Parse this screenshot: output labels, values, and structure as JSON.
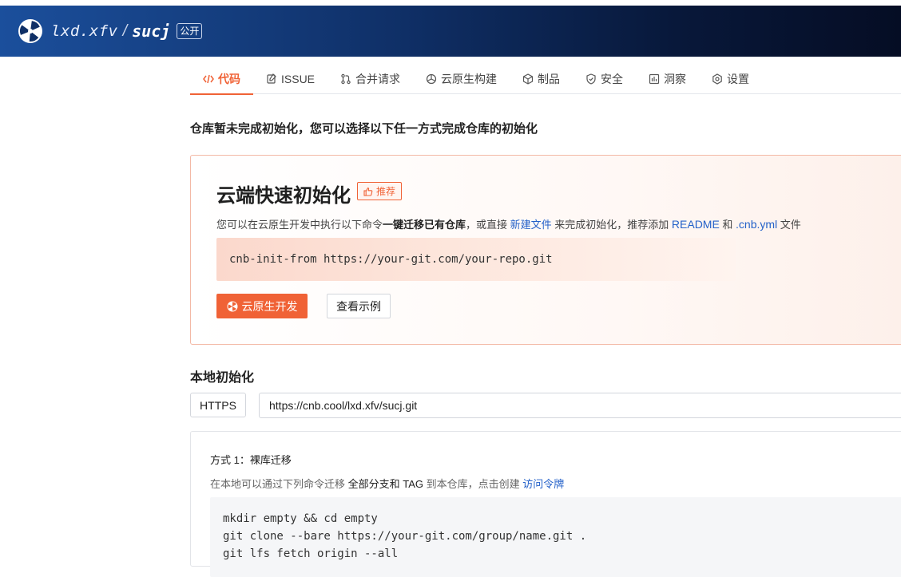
{
  "header": {
    "org": "lxd.xfv",
    "separator": "/",
    "repo": "sucj",
    "visibility_badge": "公开",
    "gradient_colors": [
      "#1b4f9c",
      "#050d24"
    ]
  },
  "tabs": [
    {
      "label": "代码",
      "icon": "code-icon",
      "active": true
    },
    {
      "label": "ISSUE",
      "icon": "issue-icon",
      "active": false
    },
    {
      "label": "合并请求",
      "icon": "pull-request-icon",
      "active": false
    },
    {
      "label": "云原生构建",
      "icon": "build-icon",
      "active": false
    },
    {
      "label": "制品",
      "icon": "package-icon",
      "active": false
    },
    {
      "label": "安全",
      "icon": "shield-icon",
      "active": false
    },
    {
      "label": "洞察",
      "icon": "chart-icon",
      "active": false
    },
    {
      "label": "设置",
      "icon": "gear-icon",
      "active": false
    }
  ],
  "notice": "仓库暂未完成初始化，您可以选择以下任一方式完成仓库的初始化",
  "cloud_init": {
    "title": "云端快速初始化",
    "badge": "推荐",
    "desc_1": "您可以在云原生开发中执行以下命令",
    "desc_bold": "一键迁移已有仓库",
    "desc_2": "，或直接 ",
    "desc_link_new_file": "新建文件",
    "desc_3": " 来完成初始化，推荐添加 ",
    "desc_link_readme": "README",
    "desc_4": " 和 ",
    "desc_link_cnb": ".cnb.yml",
    "desc_5": " 文件",
    "command": "cnb-init-from https://your-git.com/your-repo.git",
    "primary_button": "云原生开发",
    "secondary_button": "查看示例",
    "accent_color": "#f06236"
  },
  "local_init": {
    "title": "本地初始化",
    "protocol": "HTTPS",
    "clone_url": "https://cnb.cool/lxd.xfv/sucj.git",
    "method_title": "方式 1：裸库迁移",
    "method_desc_1": "在本地可以通过下列命令迁移 ",
    "method_desc_dark_1": "全部分支和 TAG",
    "method_desc_2": " 到本仓库，点击创建 ",
    "method_desc_link": "访问令牌",
    "code_lines": [
      "mkdir empty && cd empty",
      "git clone --bare https://your-git.com/group/name.git .",
      "git lfs fetch origin --all"
    ]
  }
}
